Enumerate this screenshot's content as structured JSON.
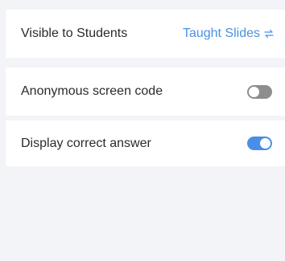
{
  "settings": {
    "visible_to_students": {
      "label": "Visible to Students",
      "value": "Taught Slides",
      "value_icon": "swap-icon"
    },
    "anonymous_screen_code": {
      "label": "Anonymous screen code",
      "enabled": false
    },
    "display_correct_answer": {
      "label": "Display correct answer",
      "enabled": true
    }
  },
  "colors": {
    "accent": "#4a90e2",
    "toggle_on": "#4a8ee8",
    "toggle_off": "#8e8e8e",
    "panel_background": "#f3f4f8",
    "row_background": "#ffffff",
    "text": "#2b2b2b"
  }
}
